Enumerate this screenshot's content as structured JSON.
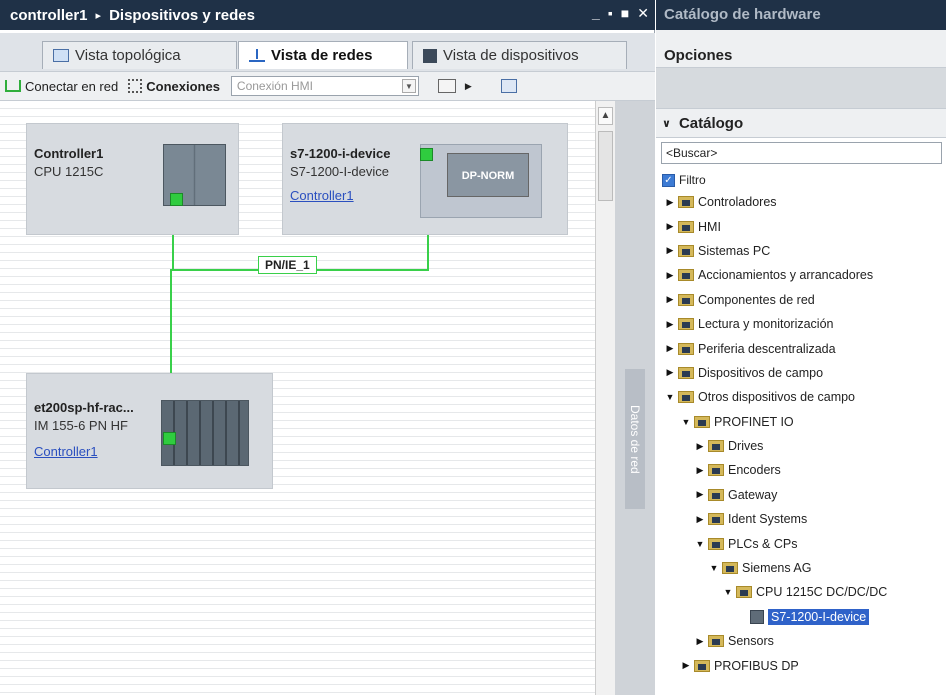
{
  "window": {
    "title": "controller1",
    "breadcrumb": "Dispositivos y redes",
    "sep": "▸",
    "controls": {
      "minimize": "_",
      "restore": "▪",
      "maximize": "■",
      "close": "✕"
    }
  },
  "tabs": [
    {
      "label": "Vista topológica",
      "icon": "topology-icon"
    },
    {
      "label": "Vista de redes",
      "icon": "network-icon"
    },
    {
      "label": "Vista de dispositivos",
      "icon": "device-view-icon"
    }
  ],
  "toolbar": {
    "connect_label": "Conectar en red",
    "connections_label": "Conexiones",
    "connection_type": "Conexión HMI"
  },
  "devices": {
    "controller": {
      "name": "Controller1",
      "type": "CPU 1215C"
    },
    "idevice": {
      "name": "s7-1200-i-device",
      "type": "S7-1200-I-device",
      "link": "Controller1",
      "module_label": "DP-NORM"
    },
    "et200": {
      "name": "et200sp-hf-rac...",
      "type": "IM 155-6 PN HF",
      "link": "Controller1"
    }
  },
  "network_label": "PN/IE_1",
  "side_tab": "Datos de red",
  "catalog": {
    "window_title": "Catálogo de hardware",
    "options": "Opciones",
    "section": "Catálogo",
    "search_placeholder": "<Buscar>",
    "filter_label": "Filtro",
    "tree": [
      {
        "label": "Controladores",
        "level": 0,
        "state": "collapsed"
      },
      {
        "label": "HMI",
        "level": 0,
        "state": "collapsed"
      },
      {
        "label": "Sistemas PC",
        "level": 0,
        "state": "collapsed"
      },
      {
        "label": "Accionamientos y arrancadores",
        "level": 0,
        "state": "collapsed"
      },
      {
        "label": "Componentes de red",
        "level": 0,
        "state": "collapsed"
      },
      {
        "label": "Lectura y monitorización",
        "level": 0,
        "state": "collapsed"
      },
      {
        "label": "Periferia descentralizada",
        "level": 0,
        "state": "collapsed"
      },
      {
        "label": "Dispositivos de campo",
        "level": 0,
        "state": "collapsed"
      },
      {
        "label": "Otros dispositivos de campo",
        "level": 0,
        "state": "expanded"
      },
      {
        "label": "PROFINET IO",
        "level": 1,
        "state": "expanded"
      },
      {
        "label": "Drives",
        "level": 2,
        "state": "collapsed"
      },
      {
        "label": "Encoders",
        "level": 2,
        "state": "collapsed"
      },
      {
        "label": "Gateway",
        "level": 2,
        "state": "collapsed"
      },
      {
        "label": "Ident Systems",
        "level": 2,
        "state": "collapsed"
      },
      {
        "label": "PLCs & CPs",
        "level": 2,
        "state": "expanded"
      },
      {
        "label": "Siemens AG",
        "level": 3,
        "state": "expanded"
      },
      {
        "label": "CPU 1215C DC/DC/DC",
        "level": 4,
        "state": "expanded"
      },
      {
        "label": "S7-1200-I-device",
        "level": 5,
        "state": "leaf",
        "selected": true
      },
      {
        "label": "Sensors",
        "level": 2,
        "state": "collapsed"
      },
      {
        "label": "PROFIBUS DP",
        "level": 1,
        "state": "collapsed"
      }
    ]
  }
}
